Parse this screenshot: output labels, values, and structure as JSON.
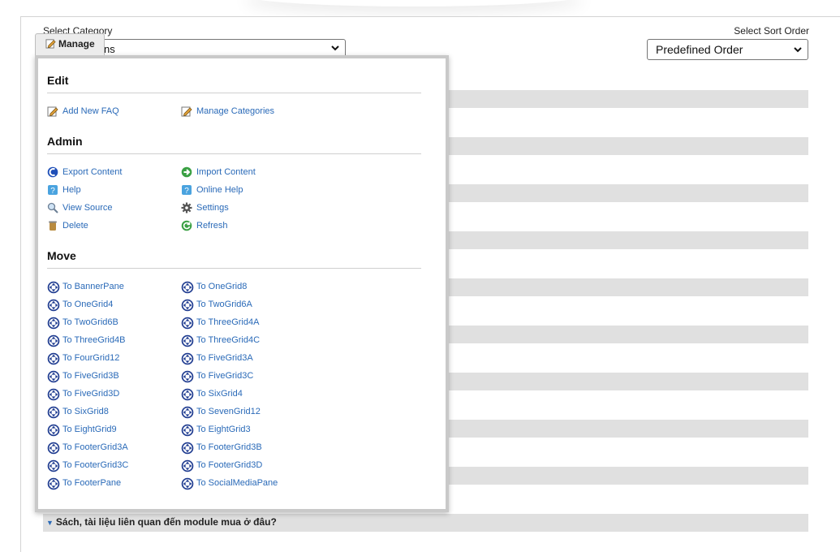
{
  "category": {
    "label": "Select Category",
    "value": "ns"
  },
  "sort": {
    "label": "Select Sort Order",
    "value": "Predefined Order"
  },
  "faq_visible_question": "Sách, tài liệu liên quan đến module mua ở đâu?",
  "manage_button_label": "Manage",
  "menu": {
    "edit": {
      "title": "Edit",
      "items": [
        {
          "label": "Add New FAQ",
          "icon": "edit-icon"
        },
        {
          "label": "Manage Categories",
          "icon": "edit-icon"
        }
      ]
    },
    "admin": {
      "title": "Admin",
      "items": [
        {
          "label": "Export Content",
          "icon": "export-icon"
        },
        {
          "label": "Import Content",
          "icon": "import-icon"
        },
        {
          "label": "Help",
          "icon": "help-icon"
        },
        {
          "label": "Online Help",
          "icon": "help-icon"
        },
        {
          "label": "View Source",
          "icon": "view-source-icon"
        },
        {
          "label": "Settings",
          "icon": "gear-icon"
        },
        {
          "label": "Delete",
          "icon": "trash-icon"
        },
        {
          "label": "Refresh",
          "icon": "refresh-icon"
        }
      ]
    },
    "move": {
      "title": "Move",
      "items": [
        "To BannerPane",
        "To OneGrid8",
        "To OneGrid4",
        "To TwoGrid6A",
        "To TwoGrid6B",
        "To ThreeGrid4A",
        "To ThreeGrid4B",
        "To ThreeGrid4C",
        "To FourGrid12",
        "To FiveGrid3A",
        "To FiveGrid3B",
        "To FiveGrid3C",
        "To FiveGrid3D",
        "To SixGrid4",
        "To SixGrid8",
        "To SevenGrid12",
        "To EightGrid9",
        "To EightGrid3",
        "To FooterGrid3A",
        "To FooterGrid3B",
        "To FooterGrid3C",
        "To FooterGrid3D",
        "To FooterPane",
        "To SocialMediaPane"
      ]
    }
  },
  "colors": {
    "link": "#2a6ab8",
    "stripe": "#e0e0e0",
    "menu_border": "#c9c9c9"
  }
}
